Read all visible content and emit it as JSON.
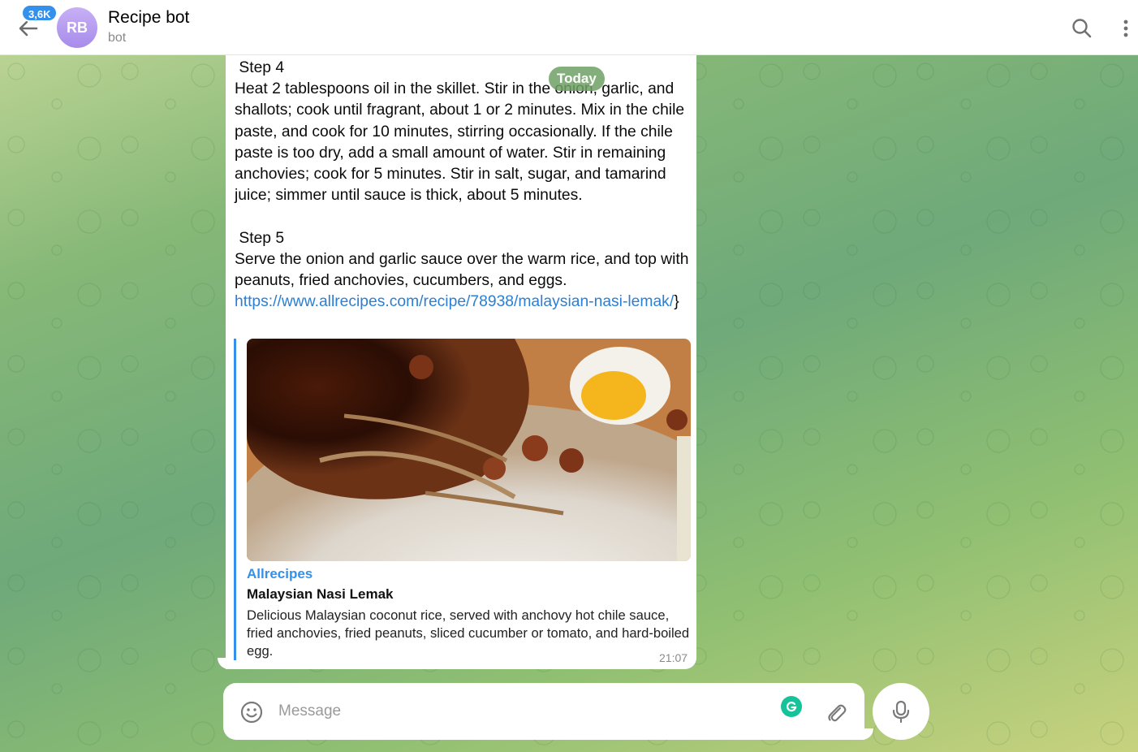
{
  "header": {
    "unread_count": "3,6K",
    "avatar_initials": "RB",
    "title": "Recipe bot",
    "status": "bot"
  },
  "date_separator": "Today",
  "message": {
    "step4_heading": " Step 4",
    "step4_text": "Heat 2 tablespoons oil in the skillet. Stir in the onion, garlic, and shallots; cook until fragrant, about 1 or 2 minutes. Mix in the chile paste, and cook for 10 minutes, stirring occasionally. If the chile paste is too dry, add a small amount of water. Stir in remaining anchovies; cook for 5 minutes. Stir in salt, sugar, and tamarind juice; simmer until sauce is thick, about 5 minutes.",
    "step5_heading": " Step 5",
    "step5_text": "Serve the onion and garlic sauce over the warm rice, and top with peanuts, fried anchovies, cucumbers, and eggs.",
    "link_text": "https://www.allrecipes.com/recipe/78938/malaysian-nasi-lemak/",
    "trailing_text": "}",
    "time": "21:07"
  },
  "link_preview": {
    "site_name": "Allrecipes",
    "title": "Malaysian Nasi Lemak",
    "description": "Delicious Malaysian coconut rice, served with anchovy hot chile sauce, fried anchovies, fried peanuts, sliced cucumber or tomato, and hard-boiled egg.",
    "image_icon": "food-photo"
  },
  "composer": {
    "placeholder": "Message"
  },
  "colors": {
    "accent": "#3390ec",
    "link": "#2b7fd4",
    "grammarly": "#15c39a"
  }
}
